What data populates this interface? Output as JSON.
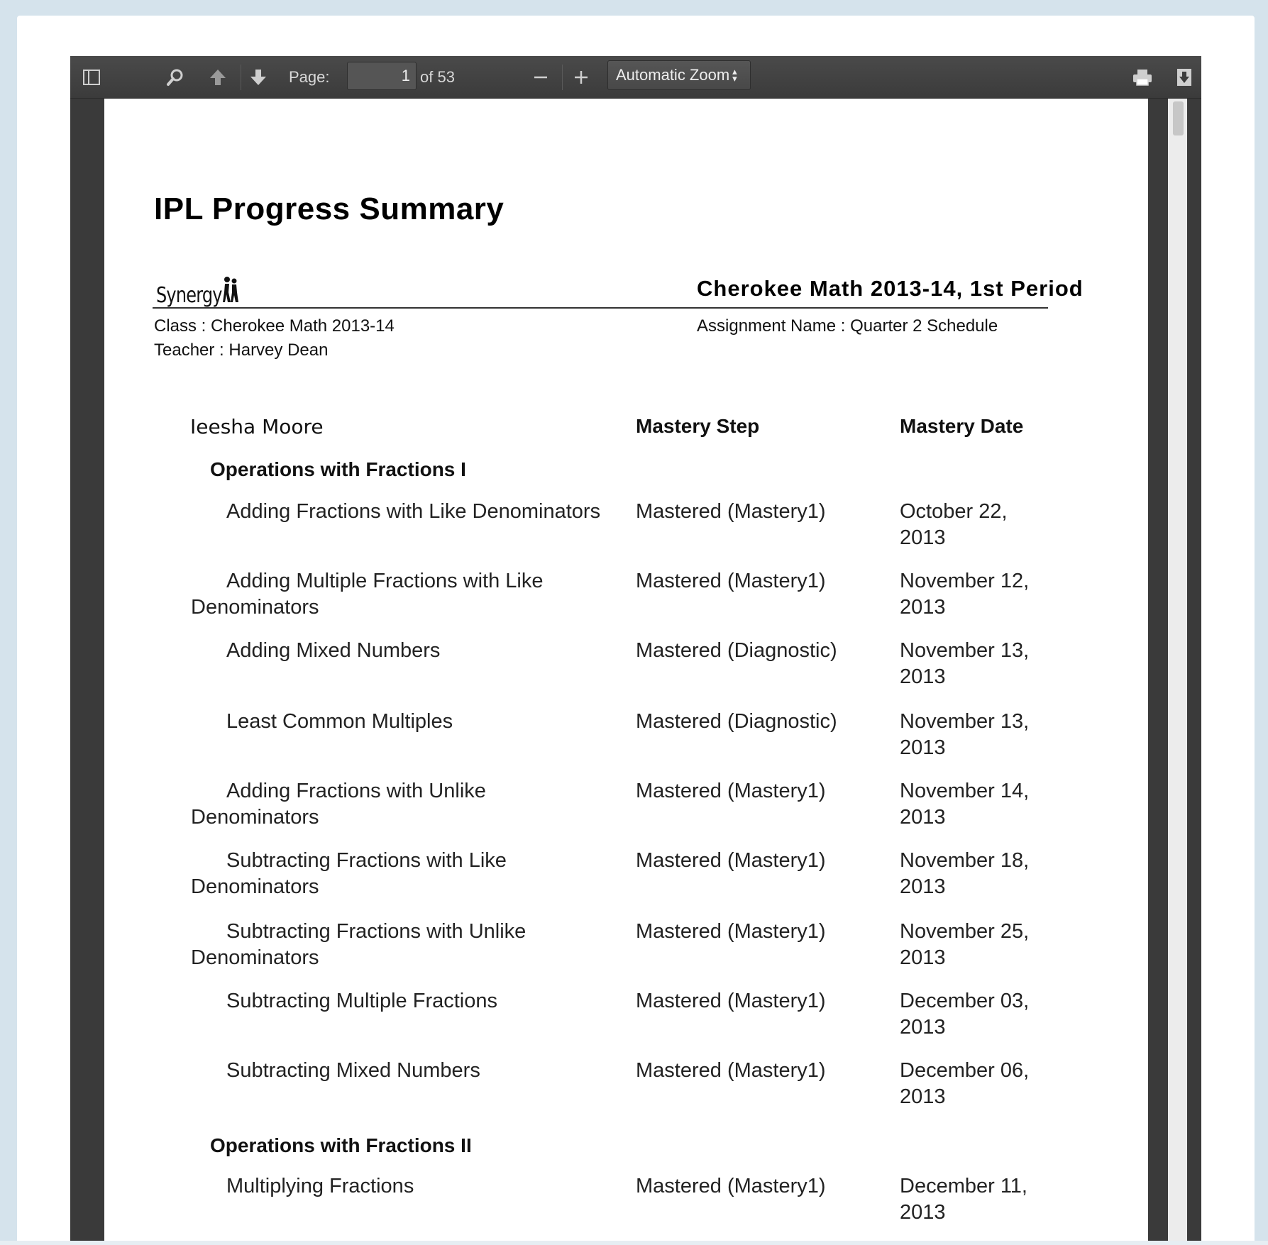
{
  "toolbar": {
    "page_label": "Page:",
    "page_value": "1",
    "page_count": "of 53",
    "zoom": "Automatic Zoom",
    "icons": [
      "sidebar-toggle-icon",
      "search-icon",
      "previous-page-icon",
      "next-page-icon",
      "zoom-out-icon",
      "zoom-in-icon",
      "print-icon",
      "download-icon"
    ]
  },
  "document": {
    "title": "IPL Progress Summary",
    "logo_text": "Synergy",
    "class_title": "Cherokee Math 2013-14, 1st Period",
    "class_line": "Class : Cherokee Math 2013-14",
    "teacher_line": "Teacher : Harvey Dean",
    "assignment_line": "Assignment Name : Quarter 2 Schedule",
    "student_name": "Ieesha Moore",
    "col_step": "Mastery Step",
    "col_date": "Mastery Date",
    "sections": [
      {
        "name": "Operations with Fractions I",
        "rows": [
          {
            "skill": "Adding Fractions with Like Denominators",
            "step": "Mastered (Mastery1)",
            "date": "October 22, 2013"
          },
          {
            "skill": "Adding Multiple Fractions with Like Denominators",
            "step": "Mastered (Mastery1)",
            "date": "November 12, 2013"
          },
          {
            "skill": "Adding Mixed Numbers",
            "step": "Mastered (Diagnostic)",
            "date": "November 13, 2013"
          },
          {
            "skill": "Least Common Multiples",
            "step": "Mastered (Diagnostic)",
            "date": "November 13, 2013"
          },
          {
            "skill": "Adding Fractions with Unlike Denominators",
            "step": "Mastered (Mastery1)",
            "date": "November 14, 2013"
          },
          {
            "skill": "Subtracting Fractions with Like Denominators",
            "step": "Mastered (Mastery1)",
            "date": "November 18, 2013"
          },
          {
            "skill": "Subtracting Fractions with Unlike Denominators",
            "step": "Mastered (Mastery1)",
            "date": "November 25, 2013"
          },
          {
            "skill": "Subtracting Multiple Fractions",
            "step": "Mastered (Mastery1)",
            "date": "December 03, 2013"
          },
          {
            "skill": "Subtracting Mixed Numbers",
            "step": "Mastered (Mastery1)",
            "date": "December 06, 2013"
          }
        ]
      },
      {
        "name": "Operations with Fractions II",
        "rows": [
          {
            "skill": "Multiplying Fractions",
            "step": "Mastered (Mastery1)",
            "date": "December 11, 2013"
          }
        ]
      }
    ]
  }
}
